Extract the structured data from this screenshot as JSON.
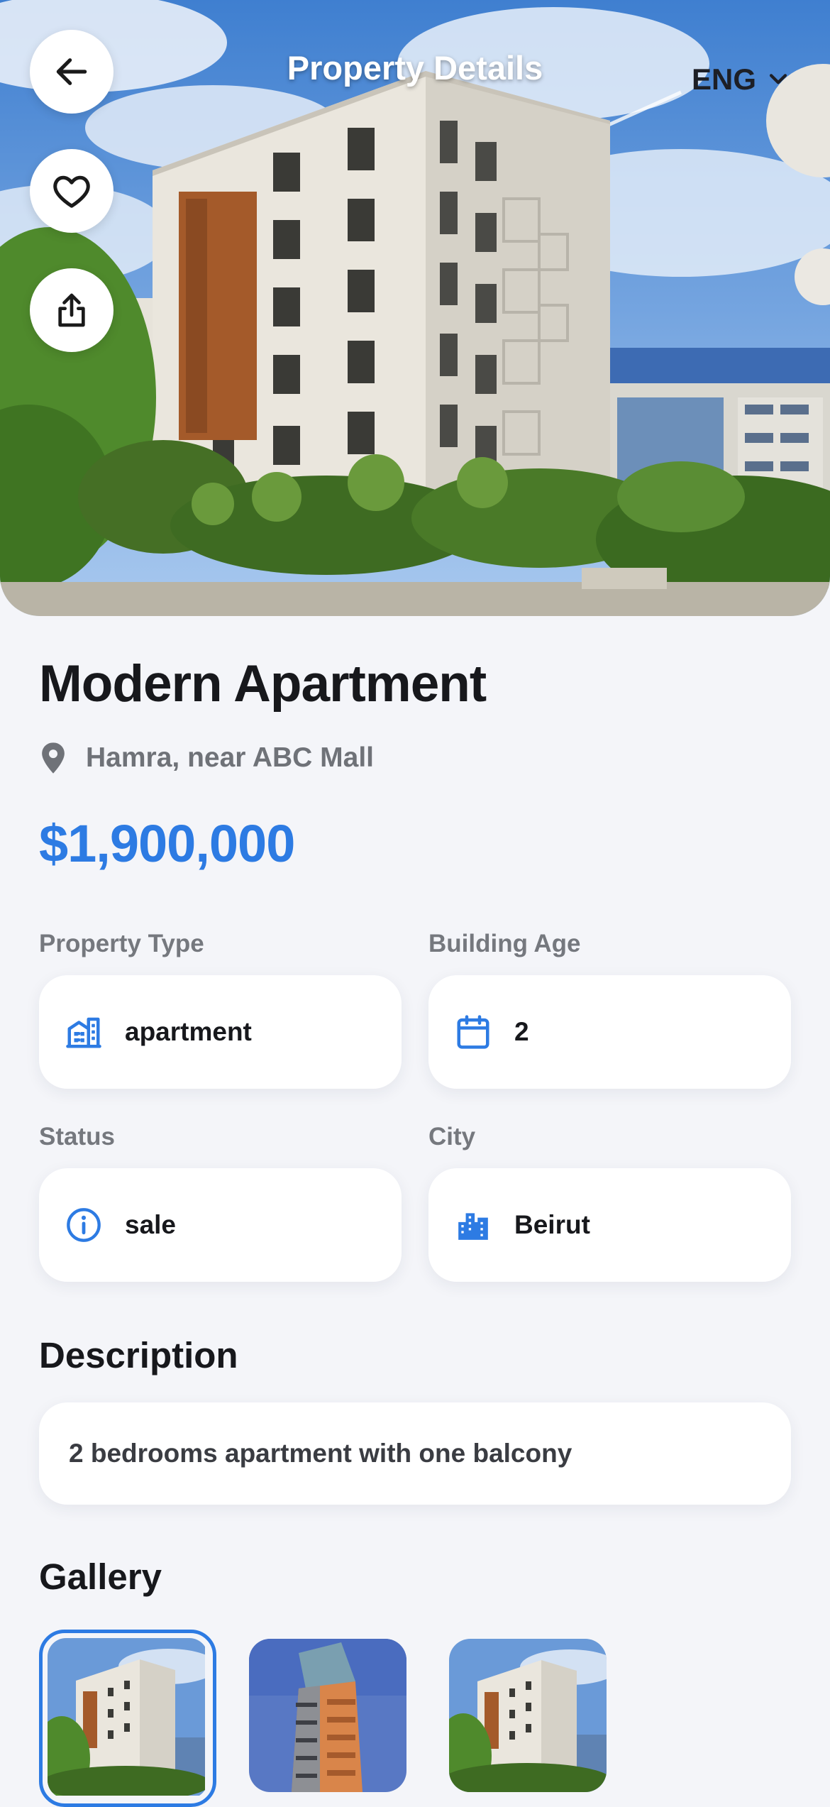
{
  "header": {
    "title": "Property Details",
    "language": "ENG",
    "back_icon": "arrow-left-icon",
    "favorite_icon": "heart-icon",
    "share_icon": "share-icon"
  },
  "property": {
    "name": "Modern Apartment",
    "location": "Hamra, near ABC Mall",
    "price": "$1,900,000"
  },
  "details": {
    "property_type": {
      "label": "Property Type",
      "value": "apartment",
      "icon": "building-icon"
    },
    "building_age": {
      "label": "Building Age",
      "value": "2",
      "icon": "calendar-icon"
    },
    "status": {
      "label": "Status",
      "value": "sale",
      "icon": "info-icon"
    },
    "city": {
      "label": "City",
      "value": "Beirut",
      "icon": "city-icon"
    }
  },
  "description": {
    "heading": "Description",
    "text": "2 bedrooms apartment with one balcony"
  },
  "gallery": {
    "heading": "Gallery",
    "selected_index": 0,
    "count": 3
  },
  "colors": {
    "accent": "#2d7be3",
    "background": "#f4f5f9",
    "text_primary": "#17181c",
    "text_secondary": "#6f7278"
  }
}
